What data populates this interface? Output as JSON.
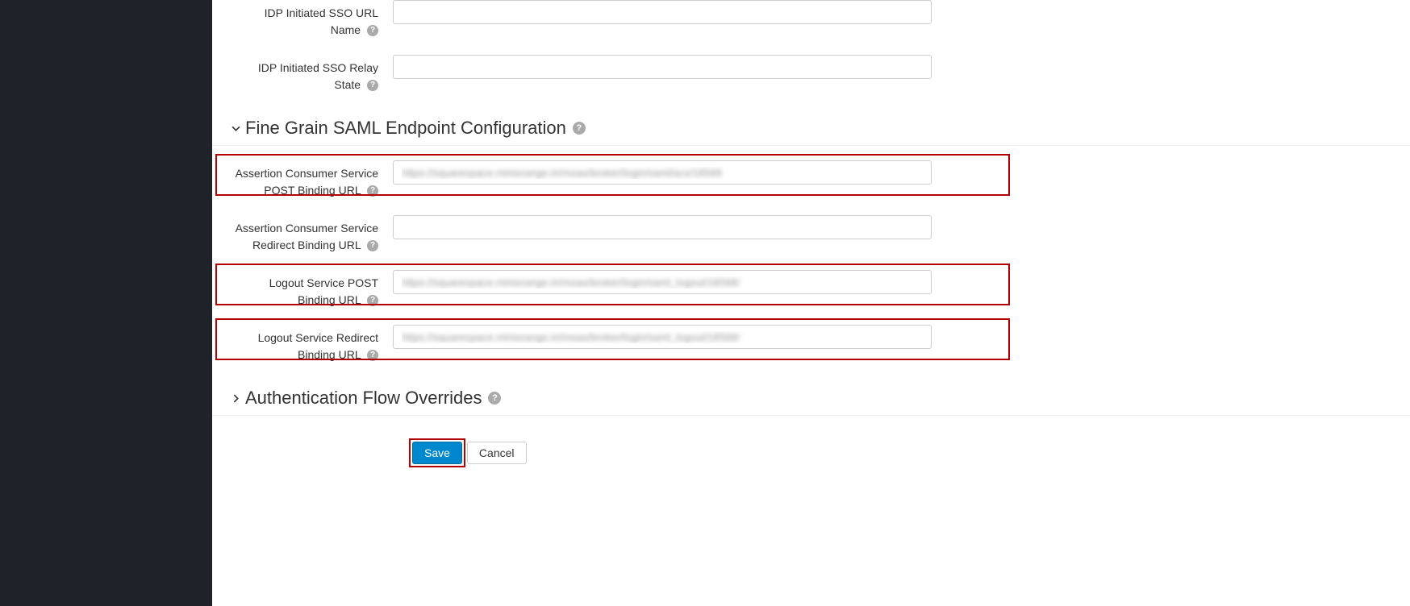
{
  "fields": {
    "idp_url_name": {
      "label": "IDP Initiated SSO URL Name",
      "value": ""
    },
    "idp_relay_state": {
      "label": "IDP Initiated SSO Relay State",
      "value": ""
    },
    "acs_post": {
      "label": "Assertion Consumer Service POST Binding URL",
      "value": "https://squarespace.miniorange.in/moas/broker/login/saml/acs/18568"
    },
    "acs_redirect": {
      "label": "Assertion Consumer Service Redirect Binding URL",
      "value": ""
    },
    "logout_post": {
      "label": "Logout Service POST Binding URL",
      "value": "https://squarespace.miniorange.in/moas/broker/login/saml_logout/18568/"
    },
    "logout_redirect": {
      "label": "Logout Service Redirect Binding URL",
      "value": "https://squarespace.miniorange.in/moas/broker/login/saml_logout/18568/"
    }
  },
  "sections": {
    "fine_grain": "Fine Grain SAML Endpoint Configuration",
    "auth_flow": "Authentication Flow Overrides"
  },
  "buttons": {
    "save": "Save",
    "cancel": "Cancel"
  },
  "icons": {
    "help": "?"
  }
}
